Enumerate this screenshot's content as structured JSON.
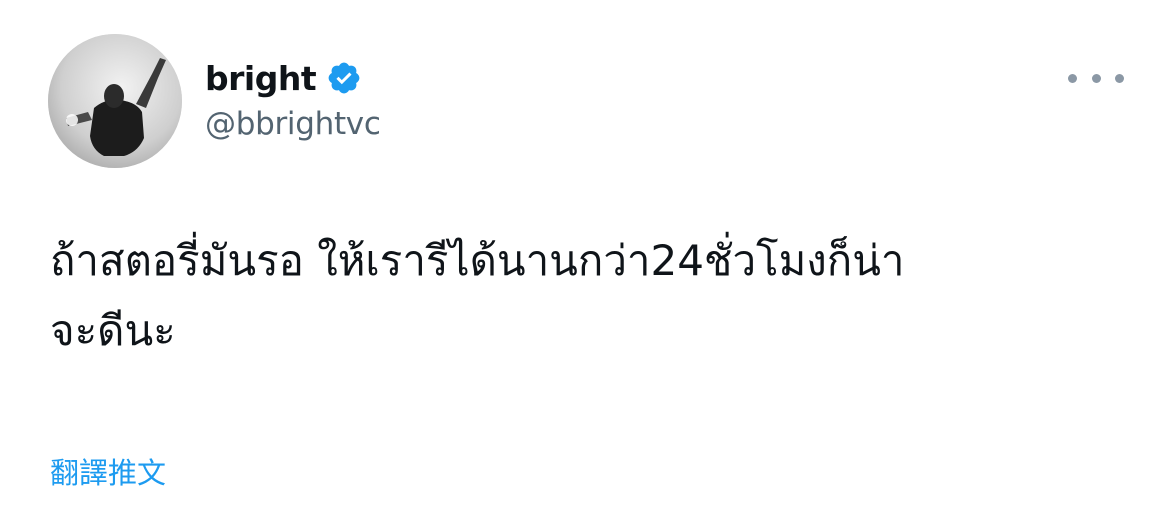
{
  "user": {
    "display_name": "bright",
    "handle": "@bbrightvc",
    "verified": true,
    "avatar_icon": "profile-photo"
  },
  "tweet": {
    "text": "ถ้าสตอรี่มันรอ ให้เรารีได้นานกว่า24ชั่วโมงก็น่า\nจะดีนะ"
  },
  "actions": {
    "translate_label": "翻譯推文",
    "more_icon": "more-dots-icon"
  },
  "colors": {
    "text": "#0f1419",
    "secondary": "#536471",
    "accent": "#1d9bf0",
    "verified_badge": "#1d9bf0"
  }
}
